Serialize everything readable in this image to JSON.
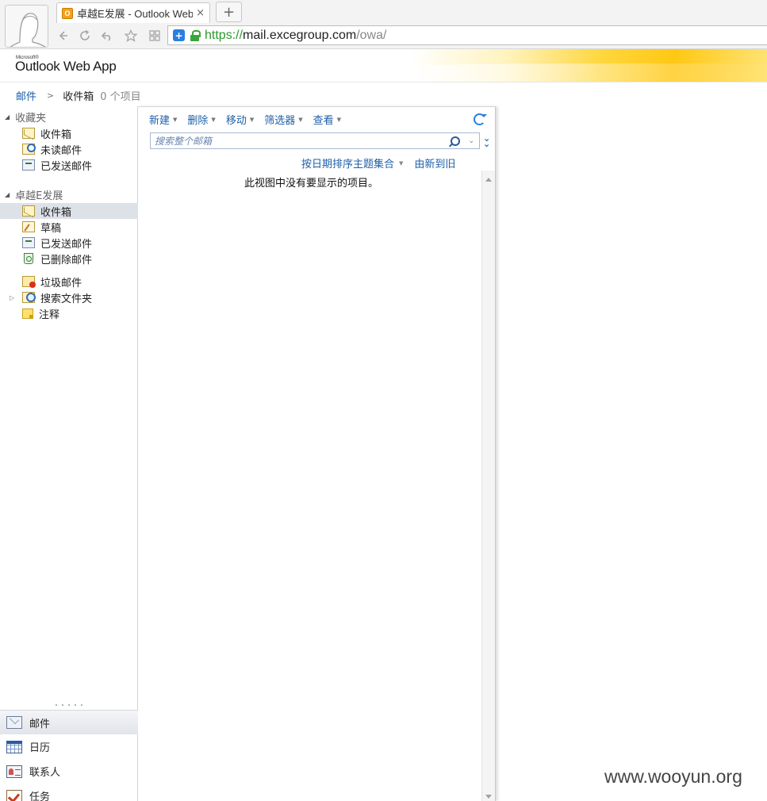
{
  "browser": {
    "tab_favicon_letter": "O",
    "tab_title": "卓越E发展 - Outlook Web App",
    "tab_close": "×",
    "new_tab": "+",
    "url": {
      "scheme": "https://",
      "host": "mail.excegroup.com",
      "path": "/owa/"
    },
    "nav_icons": [
      "back-icon",
      "reload-icon",
      "undo-icon",
      "favorite-star-icon",
      "apps-grid-icon"
    ]
  },
  "header": {
    "microsoft_small": "Microsoft®",
    "app_title": "Outlook Web App"
  },
  "breadcrumb": {
    "root": "邮件",
    "separator": ">",
    "current": "收件箱",
    "count": "0 个项目"
  },
  "favorites": {
    "title": "收藏夹",
    "items": [
      {
        "label": "收件箱",
        "icon": "inbox-icon"
      },
      {
        "label": "未读邮件",
        "icon": "unread-search-icon"
      },
      {
        "label": "已发送邮件",
        "icon": "sent-icon"
      }
    ]
  },
  "mailbox": {
    "title": "卓越E发展",
    "items": [
      {
        "label": "收件箱",
        "icon": "inbox-icon",
        "selected": true
      },
      {
        "label": "草稿",
        "icon": "drafts-icon"
      },
      {
        "label": "已发送邮件",
        "icon": "sent-icon"
      },
      {
        "label": "已删除邮件",
        "icon": "deleted-icon"
      },
      {
        "label": "垃圾邮件",
        "icon": "junk-icon"
      },
      {
        "label": "搜索文件夹",
        "icon": "search-folder-icon",
        "expandable": true
      },
      {
        "label": "注释",
        "icon": "notes-icon"
      }
    ]
  },
  "modules": [
    {
      "label": "邮件",
      "icon": "mail-module-icon",
      "selected": true
    },
    {
      "label": "日历",
      "icon": "calendar-module-icon"
    },
    {
      "label": "联系人",
      "icon": "contacts-module-icon"
    },
    {
      "label": "任务",
      "icon": "tasks-module-icon"
    }
  ],
  "toolbar": {
    "new": "新建",
    "delete": "删除",
    "move": "移动",
    "filter": "筛选器",
    "view": "查看"
  },
  "search": {
    "placeholder": "搜索整个邮箱"
  },
  "list": {
    "sort_by": "按日期排序主题集合",
    "sort_order": "由新到旧",
    "empty_message": "此视图中没有要显示的项目。"
  },
  "watermark": "www.wooyun.org",
  "colors": {
    "link_blue": "#1e5fa8",
    "selected_row": "#dde1e8",
    "url_green": "#2a9a2a",
    "header_yellow": "#ffc814"
  }
}
